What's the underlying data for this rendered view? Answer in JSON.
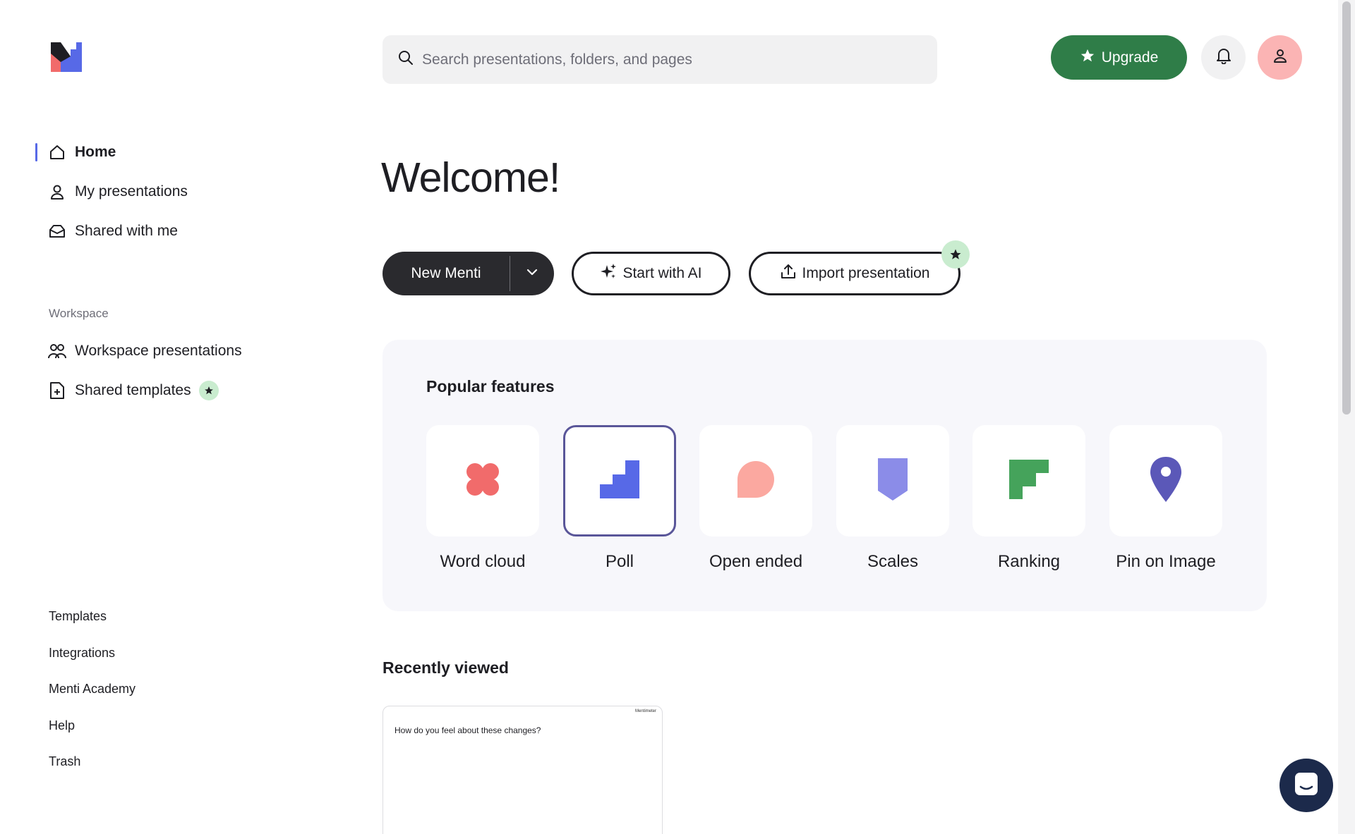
{
  "brand": {
    "logo_icon": "mentimeter-logo-icon"
  },
  "search": {
    "placeholder": "Search presentations, folders, and pages",
    "value": ""
  },
  "header": {
    "upgrade_label": "Upgrade",
    "bell_icon": "bell-icon",
    "avatar_icon": "user-icon"
  },
  "sidebar": {
    "primary": [
      {
        "label": "Home",
        "icon": "home-icon",
        "active": true
      },
      {
        "label": "My presentations",
        "icon": "user-icon"
      },
      {
        "label": "Shared with me",
        "icon": "inbox-icon"
      }
    ],
    "workspace_label": "Workspace",
    "workspace": [
      {
        "label": "Workspace presentations",
        "icon": "users-icon"
      },
      {
        "label": "Shared templates",
        "icon": "file-plus-icon",
        "badge": "star-icon"
      }
    ],
    "footer": [
      "Templates",
      "Integrations",
      "Menti Academy",
      "Help",
      "Trash"
    ]
  },
  "main": {
    "welcome": "Welcome!",
    "actions": {
      "new_menti": "New Menti",
      "start_ai": "Start with AI",
      "import": "Import presentation"
    },
    "popular": {
      "title": "Popular features",
      "items": [
        {
          "label": "Word cloud",
          "icon": "word-cloud-icon",
          "color": "#f16b6b"
        },
        {
          "label": "Poll",
          "icon": "poll-icon",
          "color": "#5769e7",
          "selected": true
        },
        {
          "label": "Open ended",
          "icon": "open-ended-icon",
          "color": "#fba8a0"
        },
        {
          "label": "Scales",
          "icon": "scales-icon",
          "color": "#8b8ce8"
        },
        {
          "label": "Ranking",
          "icon": "ranking-icon",
          "color": "#45a35b"
        },
        {
          "label": "Pin on Image",
          "icon": "pin-icon",
          "color": "#5b58b8"
        }
      ]
    },
    "recent": {
      "title": "Recently viewed",
      "items": [
        {
          "question": "How do you feel about these changes?",
          "brand": "Mentimeter"
        }
      ]
    }
  },
  "colors": {
    "accent_green": "#2f7d48",
    "dark": "#2a2a2e",
    "panel_bg": "#f7f7fb",
    "avatar_bg": "#fbb4b4",
    "chat_bg": "#1c2a4b"
  }
}
